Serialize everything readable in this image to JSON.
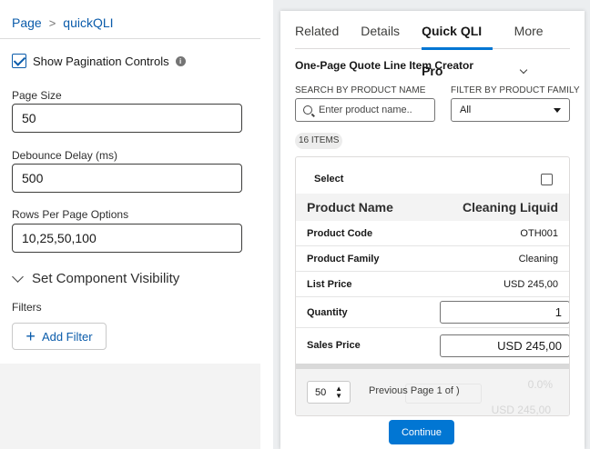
{
  "breadcrumb": {
    "root": "Page",
    "current": "quickQLI"
  },
  "properties": {
    "show_pagination_label": "Show Pagination Controls",
    "page_size_label": "Page Size",
    "page_size_value": "50",
    "debounce_label": "Debounce Delay (ms)",
    "debounce_value": "500",
    "rows_options_label": "Rows Per Page Options",
    "rows_options_value": "10,25,50,100",
    "visibility_section": "Set Component Visibility",
    "filters_label": "Filters",
    "add_filter_label": "Add Filter"
  },
  "tabs": [
    {
      "label": "Related"
    },
    {
      "label": "Details"
    },
    {
      "label": "Quick QLI Pro"
    },
    {
      "label": "More"
    }
  ],
  "component": {
    "title": "One-Page Quote Line Item Creator",
    "search_label": "SEARCH BY PRODUCT NAME",
    "search_placeholder": "Enter product name..",
    "filter_label": "FILTER BY PRODUCT FAMILY",
    "filter_value": "All",
    "items_badge": "16 ITEMS",
    "select_label": "Select",
    "product_name_label": "Product Name",
    "product_name_value": "Cleaning Liquid",
    "rows": [
      {
        "label": "Product Code",
        "value": "OTH001"
      },
      {
        "label": "Product Family",
        "value": "Cleaning"
      },
      {
        "label": "List Price",
        "value": "USD 245,00"
      }
    ],
    "quantity_label": "Quantity",
    "quantity_value": "1",
    "sales_price_label": "Sales Price",
    "sales_price_value": "USD 245,00",
    "pager_size": "50",
    "pager_text": "Previous  Page 1 of )",
    "ghost_discount": "0.0%",
    "ghost_total": "USD 245,00",
    "continue_label": "Continue"
  },
  "colors": {
    "brand": "#0176d3",
    "link": "#0b5cab"
  }
}
